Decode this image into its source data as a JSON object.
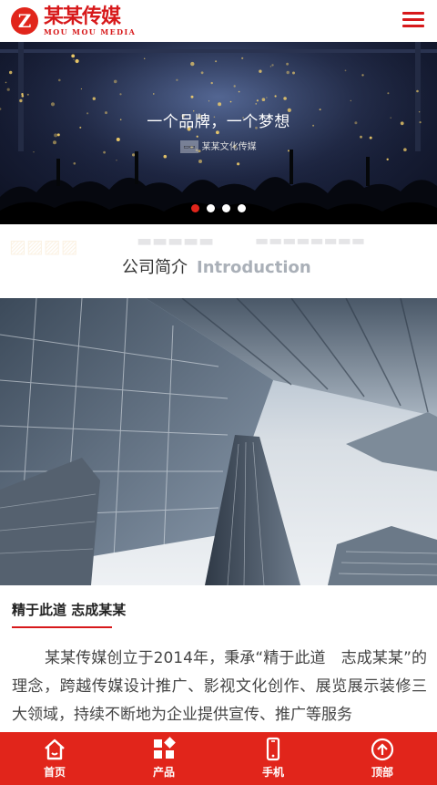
{
  "header": {
    "logo_cn": "某某传媒",
    "logo_en": "MOU MOU MEDIA",
    "logo_mark": "Z"
  },
  "banner": {
    "title": "一个品牌，一个梦想",
    "subtitle": "某某文化传媒",
    "slide_count": 4,
    "active_slide": 1
  },
  "section": {
    "title_cn": "公司简介",
    "title_en": "Introduction"
  },
  "intro": {
    "title": "精于此道 志成某某",
    "text": "某某传媒创立于2014年，秉承“精于此道　志成某某”的理念，跨越传媒设计推广、影视文化创作、展览展示装修三大领域，持续不断地为企业提供宣传、推广等服务"
  },
  "bottom_nav": [
    {
      "label": "首页",
      "icon": "home-icon"
    },
    {
      "label": "产品",
      "icon": "grid-icon"
    },
    {
      "label": "手机",
      "icon": "phone-icon"
    },
    {
      "label": "顶部",
      "icon": "arrow-up-icon"
    }
  ],
  "colors": {
    "brand_red": "#e1251b",
    "heading_en": "#aab0b8"
  }
}
